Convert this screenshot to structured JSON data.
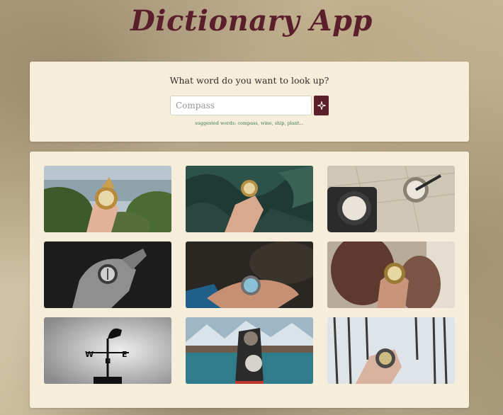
{
  "app": {
    "title": "Dictionary App"
  },
  "search": {
    "question": "What word do you want to look up?",
    "placeholder": "Compass",
    "suggestions": "suggested words: compass, wine, ship, plant..."
  },
  "icons": {
    "search_button": "sparkle-icon"
  },
  "colors": {
    "accent": "#5a1f2a",
    "panel": "#f6eedb",
    "suggestion_text": "#3d7a4d"
  },
  "gallery": {
    "images": [
      {
        "name": "hand-compass-coast-photo"
      },
      {
        "name": "hand-compass-foliage-photo"
      },
      {
        "name": "compasses-on-map-photo"
      },
      {
        "name": "bw-hand-compass-photo"
      },
      {
        "name": "open-palm-compass-photo"
      },
      {
        "name": "person-holding-compass-photo"
      },
      {
        "name": "weather-vane-rooster-photo"
      },
      {
        "name": "gloved-hand-compass-fjord-photo"
      },
      {
        "name": "hand-compass-snowy-forest-photo"
      }
    ]
  }
}
